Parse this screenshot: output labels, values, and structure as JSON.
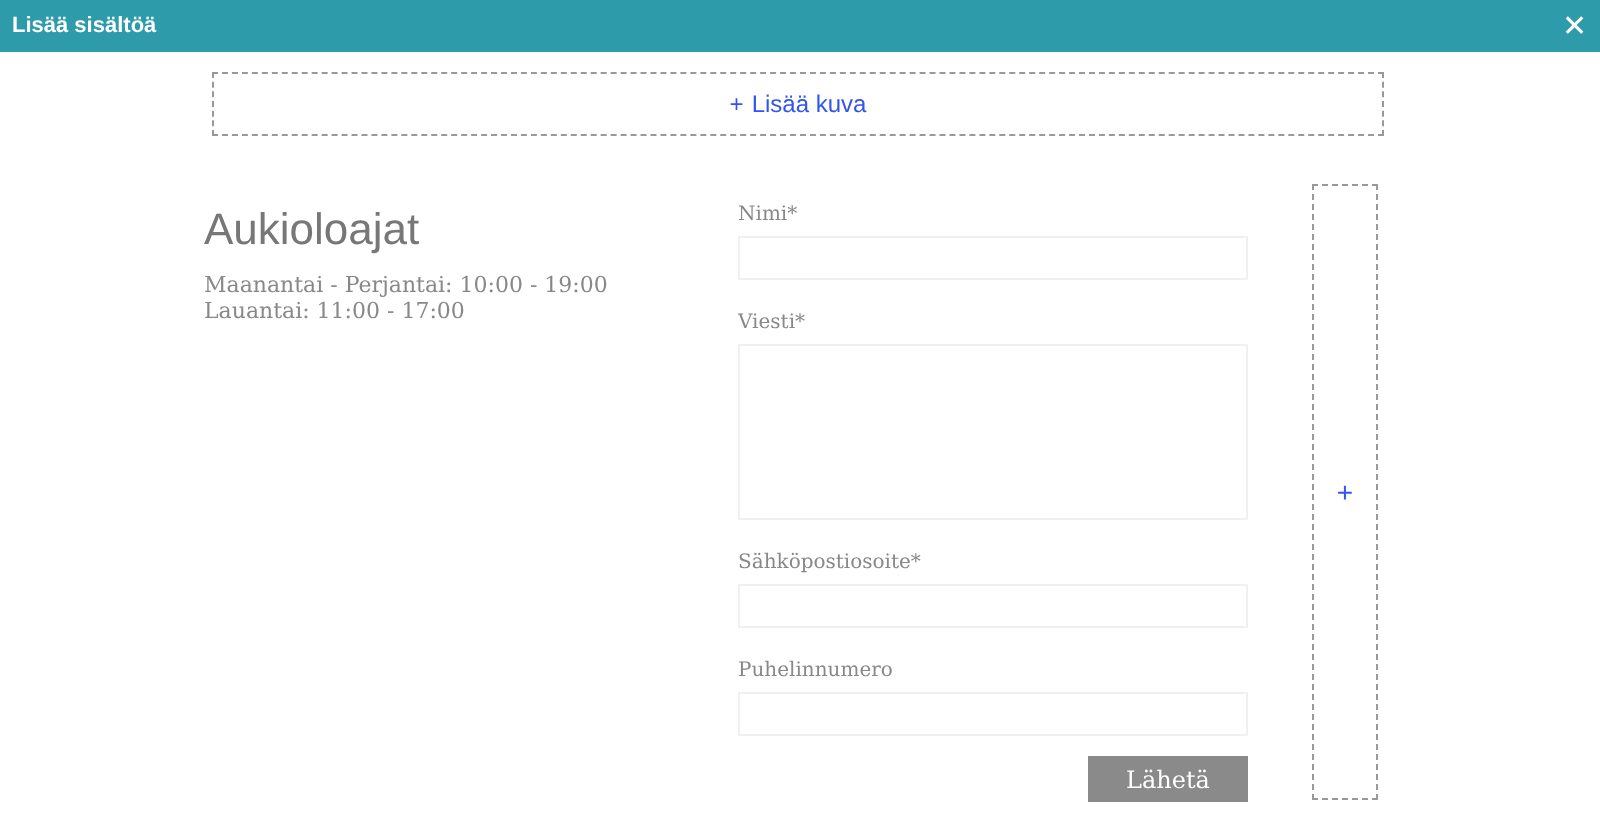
{
  "window": {
    "title": "Lisää sisältöä",
    "close": "✕"
  },
  "add_image": {
    "icon": "+",
    "label": "Lisää kuva"
  },
  "hours": {
    "title": "Aukioloajat",
    "lines": [
      "Maanantai - Perjantai: 10:00 - 19:00",
      "Lauantai: 11:00 - 17:00"
    ]
  },
  "form": {
    "fields": [
      {
        "label": "Nimi*",
        "kind": "input"
      },
      {
        "label": "Viesti*",
        "kind": "textarea"
      },
      {
        "label": "Sähköpostiosoite*",
        "kind": "input"
      },
      {
        "label": "Puhelinnumero",
        "kind": "input"
      }
    ],
    "submit": "Lähetä"
  },
  "add_column": {
    "icon": "+"
  }
}
